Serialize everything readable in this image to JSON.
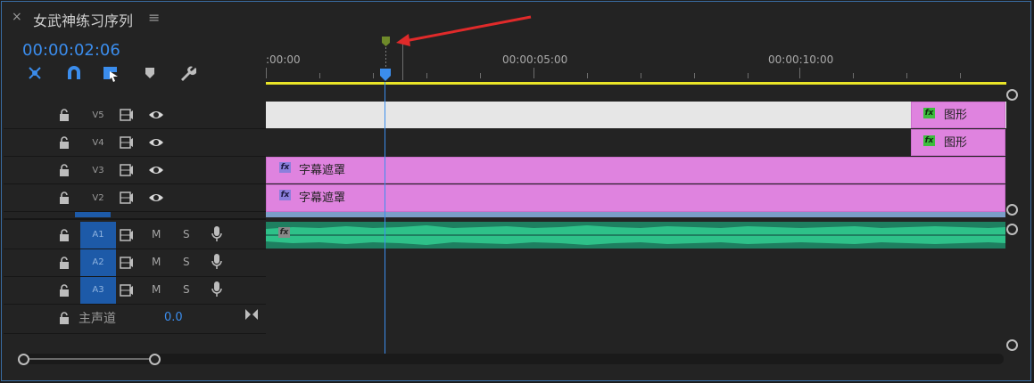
{
  "panel": {
    "close_glyph": "×",
    "title": "女武神练习序列",
    "menu_glyph": "≡",
    "timecode": "00:00:02:06"
  },
  "toolbar": {
    "icons": [
      "ripple-tool-icon",
      "snap-magnet-icon",
      "linked-selection-icon",
      "add-marker-icon",
      "wrench-settings-icon"
    ]
  },
  "ruler": {
    "labels": [
      ":00:00",
      "00:00:05:00",
      "00:00:10:00"
    ]
  },
  "tracks": {
    "video": [
      {
        "name": "V5"
      },
      {
        "name": "V4"
      },
      {
        "name": "V3"
      },
      {
        "name": "V2"
      }
    ],
    "audio": [
      {
        "name": "A1",
        "m": "M",
        "s": "S"
      },
      {
        "name": "A2",
        "m": "M",
        "s": "S"
      },
      {
        "name": "A3",
        "m": "M",
        "s": "S"
      }
    ],
    "master": {
      "name": "主声道",
      "value": "0.0"
    }
  },
  "clips": {
    "v5_label": "图形",
    "v4_label": "图形",
    "v3_label": "字幕遮罩",
    "v2_label": "字幕遮罩",
    "fx_label": "fx"
  },
  "colors": {
    "accent": "#3b8ded",
    "clip_pink": "#df83df",
    "audio_green": "#2ec189",
    "work_area": "#e9e428",
    "arrow_red": "#e02a2a"
  }
}
